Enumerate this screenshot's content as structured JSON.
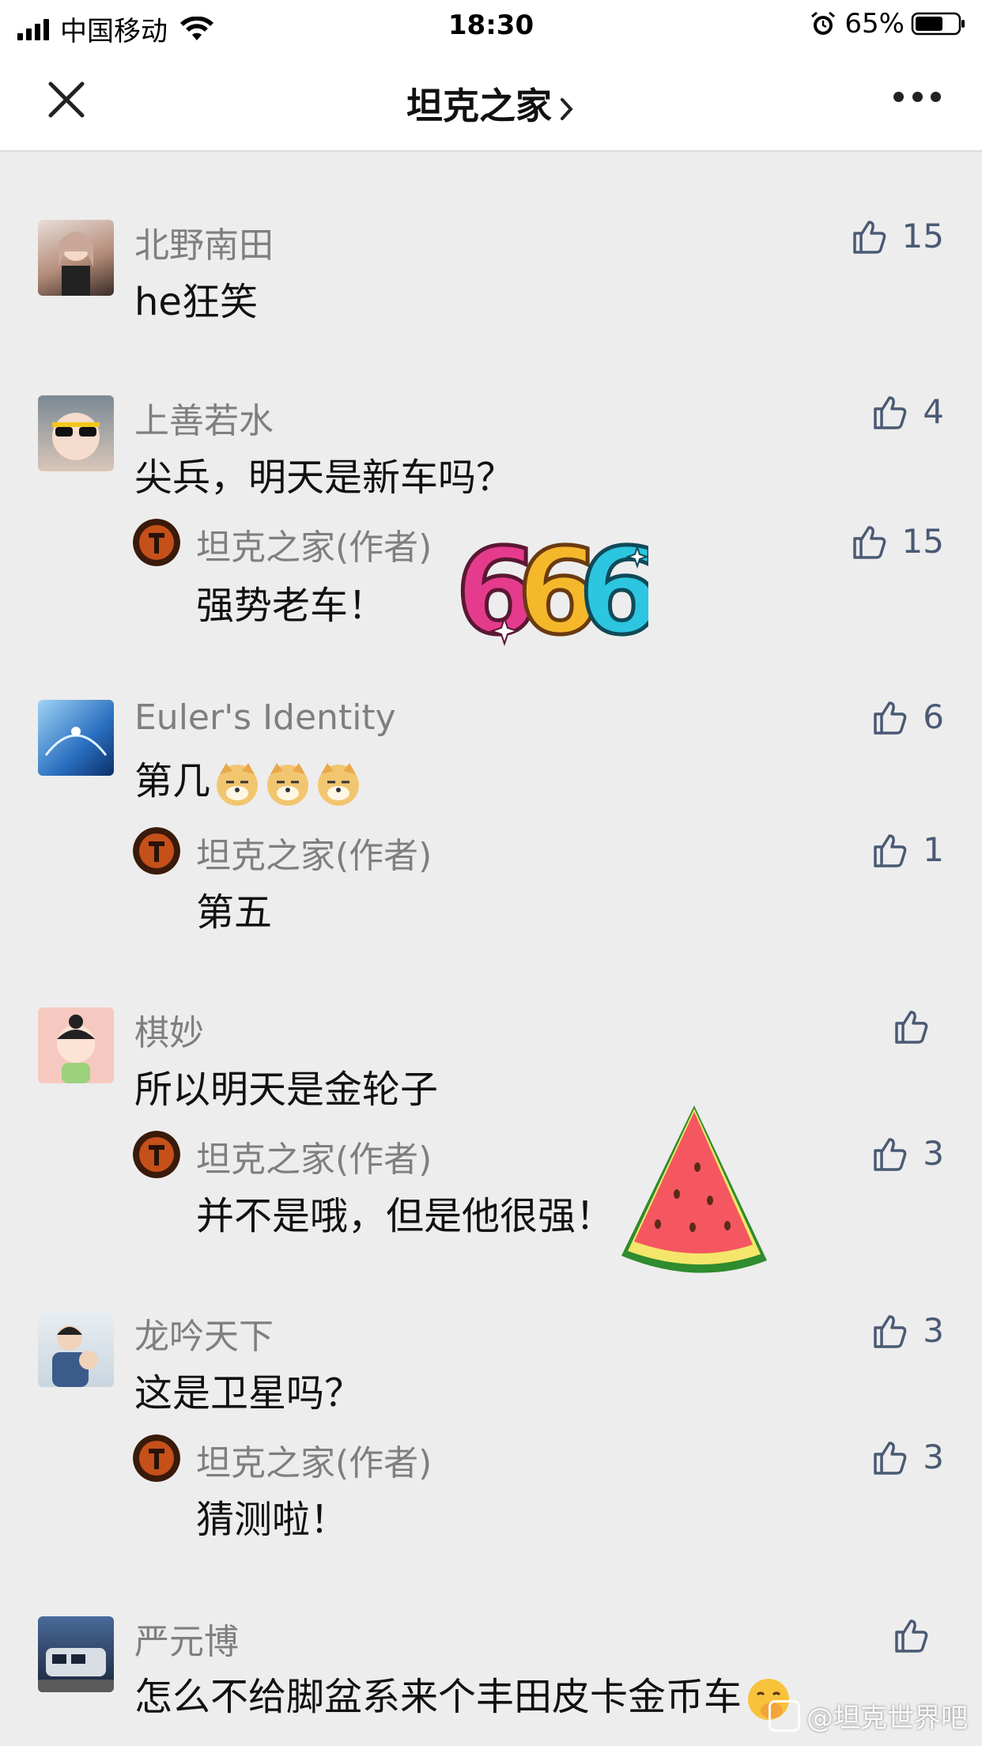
{
  "status_bar": {
    "carrier": "中国移动",
    "time": "18:30",
    "battery": "65%",
    "battery_level": 0.65
  },
  "nav": {
    "title": "坦克之家",
    "close_icon": "close-icon",
    "more_icon": "more-icon"
  },
  "comments": [
    {
      "name": "北野南田",
      "text": "he狂笑",
      "likes": "15",
      "replies": []
    },
    {
      "name": "上善若水",
      "text": "尖兵，明天是新车吗？",
      "likes": "4",
      "replies": [
        {
          "name": "坦克之家(作者)",
          "text": "强势老车！",
          "likes": "15",
          "sticker": "666"
        }
      ]
    },
    {
      "name": "Euler's Identity",
      "text": "第几",
      "likes": "6",
      "emoji": "doge",
      "replies": [
        {
          "name": "坦克之家(作者)",
          "text": "第五",
          "likes": "1"
        }
      ]
    },
    {
      "name": "棋妙",
      "text": "所以明天是金轮子",
      "likes": "",
      "replies": [
        {
          "name": "坦克之家(作者)",
          "text": "并不是哦，但是他很强！",
          "likes": "3",
          "sticker": "watermelon"
        }
      ]
    },
    {
      "name": "龙吟天下",
      "text": "这是卫星吗？",
      "likes": "3",
      "replies": [
        {
          "name": "坦克之家(作者)",
          "text": "猜测啦！",
          "likes": "3"
        }
      ]
    },
    {
      "name": "严元博",
      "text": "怎么不给脚盆系来个丰田皮卡金币车",
      "likes": "",
      "replies": []
    }
  ],
  "watermark": "@坦克世界吧",
  "colors": {
    "background": "#ededed",
    "like_icon": "#4a5a74",
    "name_text": "#7f7f7f"
  }
}
